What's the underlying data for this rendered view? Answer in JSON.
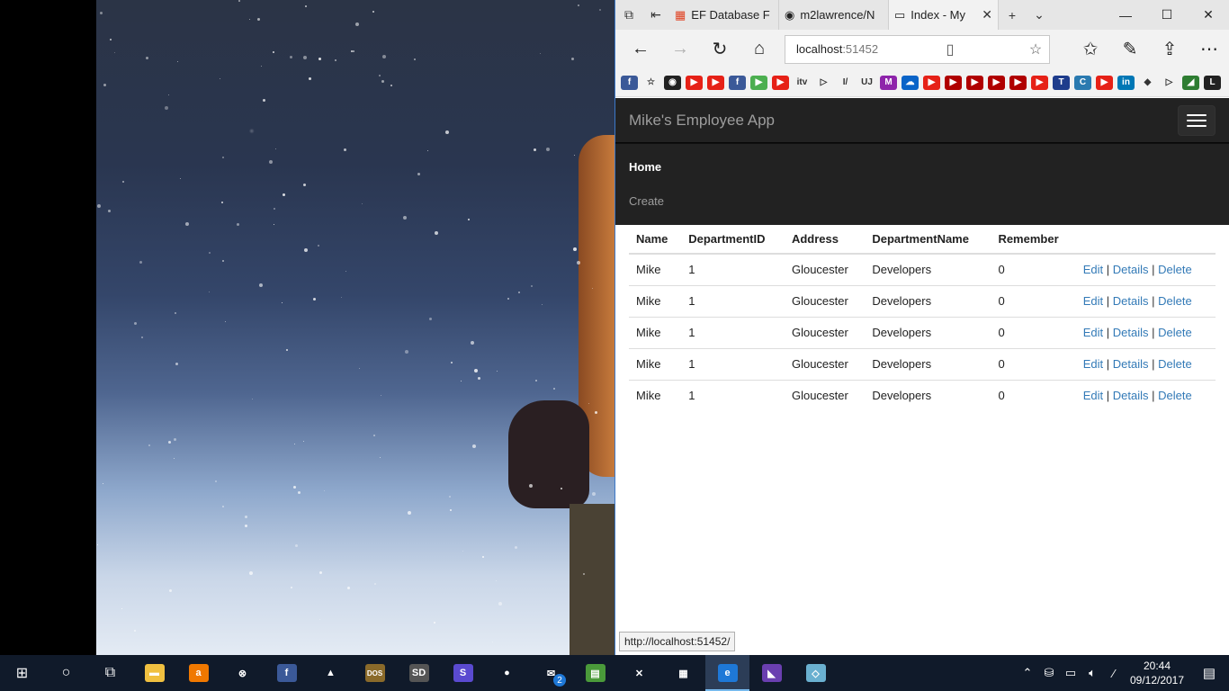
{
  "browser": {
    "tabs": [
      {
        "label": "EF Database F",
        "icon": "windows-logo-icon"
      },
      {
        "label": "m2lawrence/N",
        "icon": "github-icon"
      },
      {
        "label": "Index - My",
        "icon": "page-icon",
        "active": true
      }
    ],
    "address": {
      "host": "localhost",
      "port": ":51452"
    },
    "status_url": "http://localhost:51452/",
    "favorites": [
      {
        "icon": "facebook-icon",
        "color": "#3b5998",
        "glyph": "f"
      },
      {
        "icon": "star-outline-icon",
        "color": "#f2f2f2",
        "glyph": "☆"
      },
      {
        "icon": "github-icon",
        "color": "#222222",
        "glyph": "◉"
      },
      {
        "icon": "youtube-icon",
        "color": "#e62117",
        "glyph": "▶"
      },
      {
        "icon": "youtube-icon",
        "color": "#e62117",
        "glyph": "▶"
      },
      {
        "icon": "facebook-icon",
        "color": "#3b5998",
        "glyph": "f"
      },
      {
        "icon": "play-circle-icon",
        "color": "#4caf50",
        "glyph": "▶"
      },
      {
        "icon": "youtube-icon",
        "color": "#e62117",
        "glyph": "▶"
      },
      {
        "icon": "itv-icon",
        "color": "#f2f2f2",
        "glyph": "itv"
      },
      {
        "icon": "play-outline-icon",
        "color": "#f2f2f2",
        "glyph": "▷"
      },
      {
        "icon": "pluralsight-icon",
        "color": "#f2f2f2",
        "glyph": "I/"
      },
      {
        "icon": "uj-icon",
        "color": "#f2f2f2",
        "glyph": "UJ"
      },
      {
        "icon": "m-logo-icon",
        "color": "#8e24aa",
        "glyph": "M"
      },
      {
        "icon": "onedrive-icon",
        "color": "#0a64c8",
        "glyph": "☁"
      },
      {
        "icon": "youtube-icon",
        "color": "#e62117",
        "glyph": "▶"
      },
      {
        "icon": "youtube-icon",
        "color": "#b00000",
        "glyph": "▶"
      },
      {
        "icon": "youtube-icon",
        "color": "#b00000",
        "glyph": "▶"
      },
      {
        "icon": "youtube-icon",
        "color": "#b00000",
        "glyph": "▶"
      },
      {
        "icon": "youtube-icon",
        "color": "#b00000",
        "glyph": "▶"
      },
      {
        "icon": "youtube-icon",
        "color": "#e62117",
        "glyph": "▶"
      },
      {
        "icon": "t-logo-icon",
        "color": "#1e3c8c",
        "glyph": "T"
      },
      {
        "icon": "c-logo-icon",
        "color": "#2a7ab0",
        "glyph": "C"
      },
      {
        "icon": "youtube-icon",
        "color": "#e62117",
        "glyph": "▶"
      },
      {
        "icon": "linkedin-icon",
        "color": "#0077b5",
        "glyph": "in"
      },
      {
        "icon": "bulb-icon",
        "color": "#f2f2f2",
        "glyph": "◆"
      },
      {
        "icon": "play-outline-icon",
        "color": "#f2f2f2",
        "glyph": "▷"
      },
      {
        "icon": "chart-icon",
        "color": "#2e7d32",
        "glyph": "◢"
      },
      {
        "icon": "l-logo-icon",
        "color": "#222222",
        "glyph": "L"
      }
    ]
  },
  "app": {
    "brand": "Mike's Employee App",
    "menu": [
      {
        "label": "Home",
        "active": true
      },
      {
        "label": "Create",
        "active": false
      }
    ]
  },
  "table": {
    "headers": [
      "Name",
      "DepartmentID",
      "Address",
      "DepartmentName",
      "Remember",
      ""
    ],
    "rows": [
      [
        "Mike",
        "1",
        "Gloucester",
        "Developers",
        "0"
      ],
      [
        "Mike",
        "1",
        "Gloucester",
        "Developers",
        "0"
      ],
      [
        "Mike",
        "1",
        "Gloucester",
        "Developers",
        "0"
      ],
      [
        "Mike",
        "1",
        "Gloucester",
        "Developers",
        "0"
      ],
      [
        "Mike",
        "1",
        "Gloucester",
        "Developers",
        "0"
      ]
    ],
    "actions": [
      "Edit",
      "Details",
      "Delete"
    ],
    "separator": "|"
  },
  "taskbar": {
    "apps": [
      {
        "icon": "file-explorer-icon",
        "color": "#f0c040",
        "glyph": "▬"
      },
      {
        "icon": "avast-icon",
        "color": "#f07800",
        "glyph": "a"
      },
      {
        "icon": "xbox-icon",
        "color": "#101a2a",
        "glyph": "⊗"
      },
      {
        "icon": "facebook-icon",
        "color": "#3b5998",
        "glyph": "f"
      },
      {
        "icon": "vlc-icon",
        "color": "#101a2a",
        "glyph": "▲"
      },
      {
        "icon": "dosbox-icon",
        "color": "#8a6a2a",
        "glyph": "DOS"
      },
      {
        "icon": "sd-icon",
        "color": "#555555",
        "glyph": "SD"
      },
      {
        "icon": "sync-icon",
        "color": "#5a4ad0",
        "glyph": "S"
      },
      {
        "icon": "duck-icon",
        "color": "#101a2a",
        "glyph": "●"
      },
      {
        "icon": "mail-icon",
        "color": "#101a2a",
        "glyph": "✉"
      },
      {
        "icon": "notepad-icon",
        "color": "#4a9a3a",
        "glyph": "▤"
      },
      {
        "icon": "tools-icon",
        "color": "#101a2a",
        "glyph": "✕"
      },
      {
        "icon": "movies-icon",
        "color": "#101a2a",
        "glyph": "▦"
      },
      {
        "icon": "edge-icon",
        "color": "#1e78d7",
        "glyph": "e",
        "active": true
      },
      {
        "icon": "visual-studio-icon",
        "color": "#6a3fb0",
        "glyph": "◣"
      },
      {
        "icon": "notes-icon",
        "color": "#6ab0d0",
        "glyph": "◇"
      }
    ],
    "mail_badge": "2",
    "clock_time": "20:44",
    "clock_date": "09/12/2017"
  }
}
